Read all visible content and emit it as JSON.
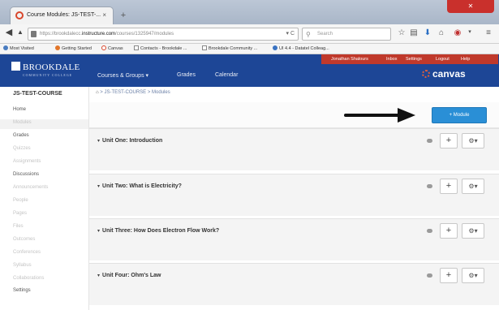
{
  "browser": {
    "tab_title": "Course Modules: JS-TEST-...",
    "tab_close": "×",
    "new_tab": "+",
    "url_host_prefix": "https://brookdalecc.",
    "url_domain": "instructure.com",
    "url_path": "/courses/1325947/modules",
    "search_placeholder": "Search",
    "bookmarks": [
      "Most Visited",
      "Getting Started",
      "Canvas",
      "Contacts - Brookdale ...",
      "Brookdale Community ...",
      "UI 4.4 - Datatel Colleag..."
    ]
  },
  "header": {
    "logo_text": "BROOKDALE",
    "logo_subtext": "COMMUNITY COLLEGE",
    "nav": [
      "Courses & Groups ▾",
      "Grades",
      "Calendar"
    ],
    "user_nav": [
      "Jonathan Shalours",
      "Inbox",
      "Settings",
      "Logout",
      "Help"
    ],
    "canvas_logo": "canvas"
  },
  "sidebar": {
    "course_name": "JS-TEST-COURSE",
    "items": [
      {
        "label": "Home",
        "enabled": true
      },
      {
        "label": "Modules",
        "enabled": false
      },
      {
        "label": "Grades",
        "enabled": true
      },
      {
        "label": "Quizzes",
        "enabled": false
      },
      {
        "label": "Assignments",
        "enabled": false
      },
      {
        "label": "Discussions",
        "enabled": true
      },
      {
        "label": "Announcements",
        "enabled": false
      },
      {
        "label": "People",
        "enabled": false
      },
      {
        "label": "Pages",
        "enabled": false
      },
      {
        "label": "Files",
        "enabled": false
      },
      {
        "label": "Outcomes",
        "enabled": false
      },
      {
        "label": "Conferences",
        "enabled": false
      },
      {
        "label": "Syllabus",
        "enabled": false
      },
      {
        "label": "Collaborations",
        "enabled": false
      },
      {
        "label": "Settings",
        "enabled": true
      }
    ]
  },
  "breadcrumb": {
    "course": "JS-TEST-COURSE",
    "separator": ">",
    "current": "Modules"
  },
  "toolbar": {
    "add_module_label": "+ Module"
  },
  "modules": [
    {
      "title": "Unit One: Introduction"
    },
    {
      "title": "Unit Two: What is Electricity?"
    },
    {
      "title": "Unit Three: How Does Electron Flow Work?"
    },
    {
      "title": "Unit Four: Ohm's Law"
    }
  ],
  "colors": {
    "header_blue": "#1d4696",
    "user_nav_red": "#c0392b",
    "button_blue": "#2a8fd6"
  }
}
